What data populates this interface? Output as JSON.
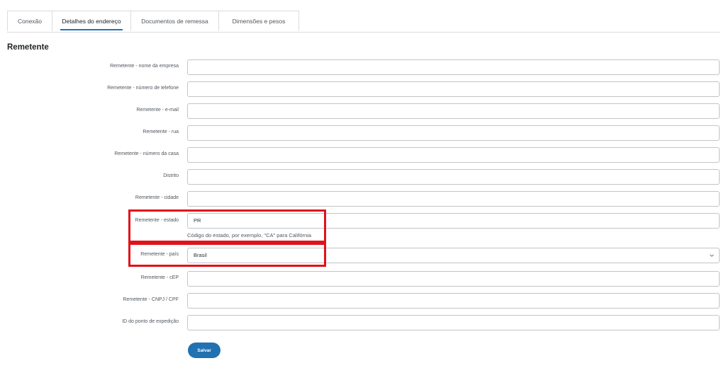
{
  "tabs": [
    {
      "label": "Conexão"
    },
    {
      "label": "Detalhes do endereço"
    },
    {
      "label": "Documentos de remessa"
    },
    {
      "label": "Dimensões e pesos"
    }
  ],
  "section_title": "Remetente",
  "fields": {
    "company_name": {
      "label": "Remetente - nome da empresa",
      "value": ""
    },
    "phone": {
      "label": "Remetente - número de telefone",
      "value": ""
    },
    "email": {
      "label": "Remetente - e-mail",
      "value": ""
    },
    "street": {
      "label": "Remetente - rua",
      "value": ""
    },
    "house_number": {
      "label": "Remetente - número da casa",
      "value": ""
    },
    "district": {
      "label": "Distrito",
      "value": ""
    },
    "city": {
      "label": "Remetente - cidade",
      "value": ""
    },
    "state": {
      "label": "Remetente - estado",
      "value": "PR",
      "help": "Código do estado, por exemplo, \"CA\" para Califórnia"
    },
    "country": {
      "label": "Remetente - país",
      "value": "Brasil"
    },
    "zip": {
      "label": "Remetente - cEP",
      "value": ""
    },
    "tax_id": {
      "label": "Remetente - CNPJ / CPF",
      "value": ""
    },
    "dispatch_point": {
      "label": "ID do ponto de expedição",
      "value": ""
    }
  },
  "save_label": "Salvar",
  "colors": {
    "accent": "#2271b1",
    "highlight": "#e0121a"
  }
}
